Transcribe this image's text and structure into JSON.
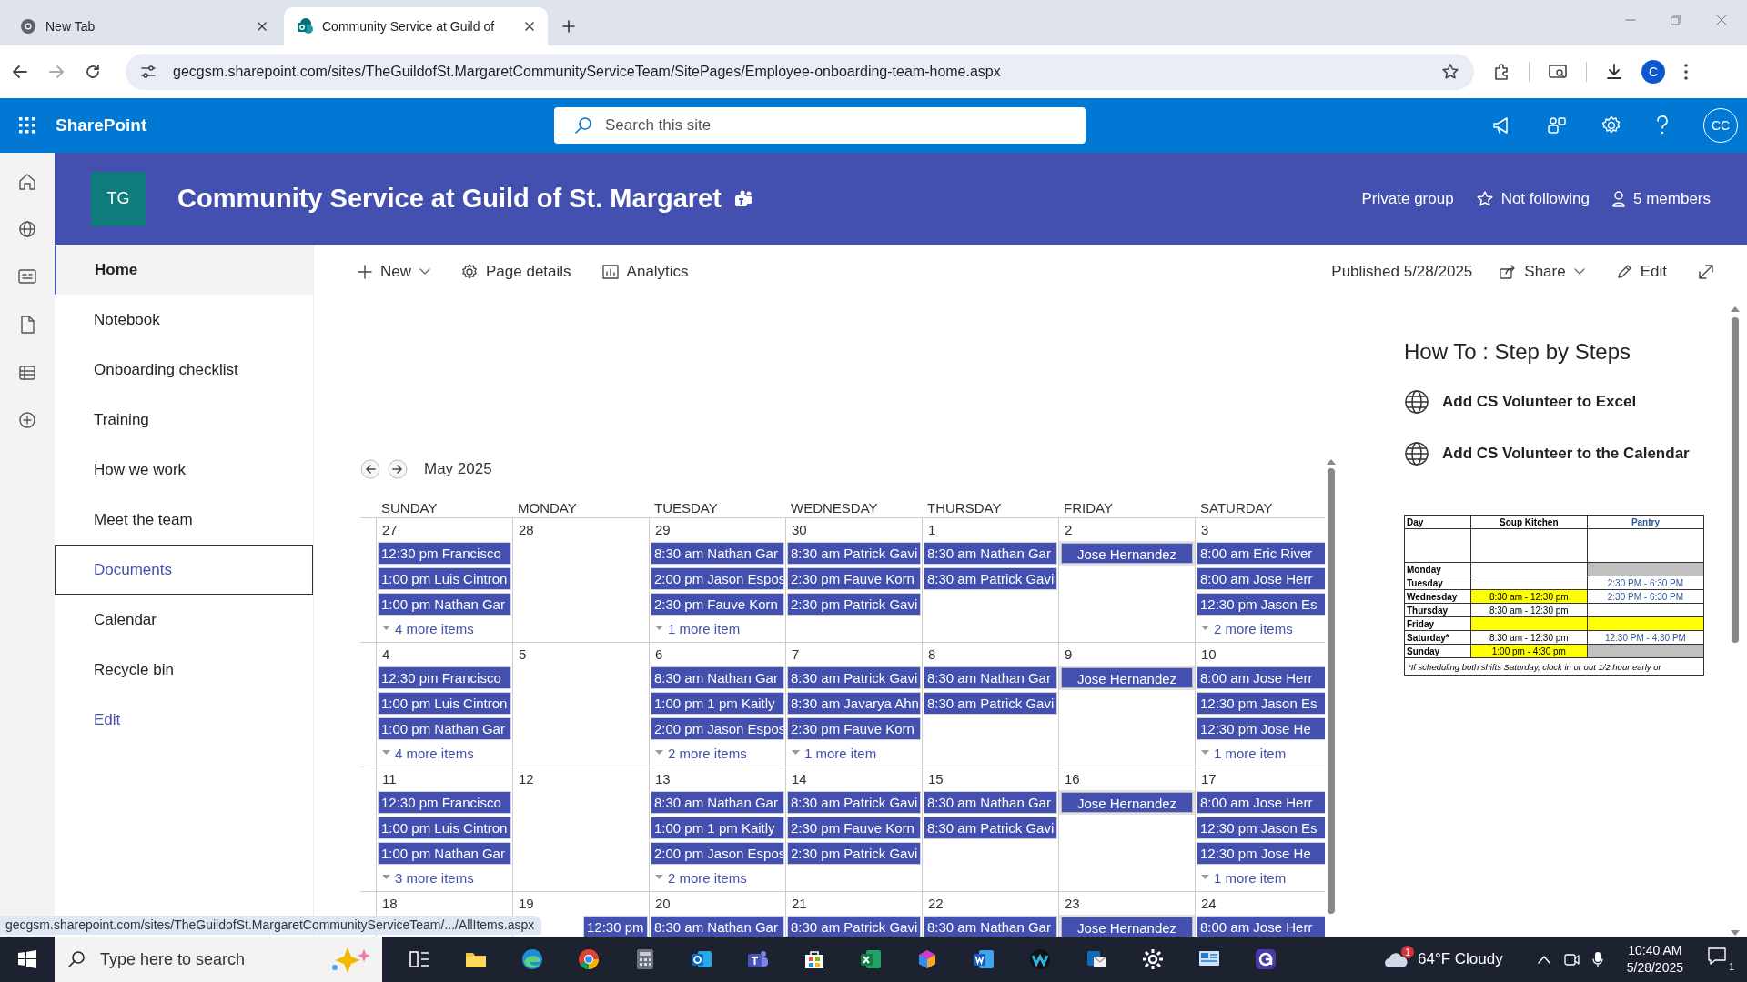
{
  "browser": {
    "tabs": [
      {
        "title": "New Tab",
        "kind": "chrome",
        "selected": false
      },
      {
        "title": "Community Service at Guild of",
        "kind": "sharepoint",
        "selected": true
      }
    ],
    "url": "gecgsm.sharepoint.com/sites/TheGuildofSt.MargaretCommunityServiceTeam/SitePages/Employee-onboarding-team-home.aspx",
    "profile": "C"
  },
  "suite_bar": {
    "app": "SharePoint",
    "search": {
      "placeholder": "Search this site"
    },
    "avatar": "CC"
  },
  "site_header": {
    "logo": "TG",
    "title": "Community Service at Guild of St. Margaret",
    "privacy": "Private group",
    "follow": "Not following",
    "members": "5 members"
  },
  "nav": [
    {
      "label": "Home",
      "kind": "page",
      "selected": true,
      "focused": false
    },
    {
      "label": "Notebook",
      "kind": "page",
      "selected": false,
      "focused": false
    },
    {
      "label": "Onboarding checklist",
      "kind": "page",
      "selected": false,
      "focused": false
    },
    {
      "label": "Training",
      "kind": "page",
      "selected": false,
      "focused": false
    },
    {
      "label": "How we work",
      "kind": "page",
      "selected": false,
      "focused": false
    },
    {
      "label": "Meet the team",
      "kind": "page",
      "selected": false,
      "focused": false
    },
    {
      "label": "Documents",
      "kind": "page",
      "selected": false,
      "focused": true
    },
    {
      "label": "Calendar",
      "kind": "page",
      "selected": false,
      "focused": false
    },
    {
      "label": "Recycle bin",
      "kind": "page",
      "selected": false,
      "focused": false
    },
    {
      "label": "Edit",
      "kind": "link",
      "selected": false,
      "focused": false
    }
  ],
  "command_bar": {
    "left": [
      {
        "label": "New",
        "kind": "new"
      },
      {
        "label": "Page details",
        "kind": "details"
      },
      {
        "label": "Analytics",
        "kind": "analytics"
      }
    ],
    "published": "Published 5/28/2025",
    "right": [
      {
        "label": "Share",
        "kind": "share"
      },
      {
        "label": "Edit",
        "kind": "edit"
      }
    ]
  },
  "calendar": {
    "month": "May 2025",
    "days": [
      "SUNDAY",
      "MONDAY",
      "TUESDAY",
      "WEDNESDAY",
      "THURSDAY",
      "FRIDAY",
      "SATURDAY"
    ],
    "weeks": [
      {
        "dates": [
          {
            "date": "27",
            "events": [
              {
                "text": "12:30 pm Francisco",
                "kind": "timed"
              },
              {
                "text": "1:00 pm Luis Cintron",
                "kind": "timed"
              },
              {
                "text": "1:00 pm Nathan Gar",
                "kind": "timed"
              }
            ],
            "more": "4 more items"
          },
          {
            "date": "28"
          },
          {
            "date": "29",
            "events": [
              {
                "text": "8:30 am Nathan Gar",
                "kind": "timed"
              },
              {
                "text": "2:00 pm Jason Espos",
                "kind": "timed"
              },
              {
                "text": "2:30 pm Fauve Korn",
                "kind": "timed"
              }
            ],
            "more": "1 more item"
          },
          {
            "date": "30",
            "events": [
              {
                "text": "8:30 am Patrick Gavi",
                "kind": "timed"
              },
              {
                "text": "2:30 pm Fauve Korn",
                "kind": "timed"
              },
              {
                "text": "2:30 pm Patrick Gavi",
                "kind": "timed"
              }
            ]
          },
          {
            "date": "1",
            "events": [
              {
                "text": "8:30 am Nathan Gar",
                "kind": "timed"
              },
              {
                "text": "8:30 am Patrick Gavi",
                "kind": "timed"
              }
            ]
          },
          {
            "date": "2",
            "events": [
              {
                "text": "Jose Hernandez",
                "kind": "allday"
              }
            ]
          },
          {
            "date": "3",
            "events": [
              {
                "text": "8:00 am Eric River",
                "kind": "timed"
              },
              {
                "text": "8:00 am Jose Herr",
                "kind": "timed"
              },
              {
                "text": "12:30 pm Jason Es",
                "kind": "timed"
              }
            ],
            "more": "2 more items"
          }
        ]
      },
      {
        "dates": [
          {
            "date": "4",
            "events": [
              {
                "text": "12:30 pm Francisco",
                "kind": "timed"
              },
              {
                "text": "1:00 pm Luis Cintron",
                "kind": "timed"
              },
              {
                "text": "1:00 pm Nathan Gar",
                "kind": "timed"
              }
            ],
            "more": "4 more items"
          },
          {
            "date": "5"
          },
          {
            "date": "6",
            "events": [
              {
                "text": "8:30 am Nathan Gar",
                "kind": "timed"
              },
              {
                "text": "1:00 pm 1 pm Kaitly",
                "kind": "timed"
              },
              {
                "text": "2:00 pm Jason Espos",
                "kind": "timed"
              }
            ],
            "more": "2 more items"
          },
          {
            "date": "7",
            "events": [
              {
                "text": "8:30 am Patrick Gavi",
                "kind": "timed"
              },
              {
                "text": "8:30 am Javarya Ahn",
                "kind": "timed"
              },
              {
                "text": "2:30 pm Fauve Korn",
                "kind": "timed"
              }
            ],
            "more": "1 more item"
          },
          {
            "date": "8",
            "events": [
              {
                "text": "8:30 am Nathan Gar",
                "kind": "timed"
              },
              {
                "text": "8:30 am Patrick Gavi",
                "kind": "timed"
              }
            ]
          },
          {
            "date": "9",
            "events": [
              {
                "text": "Jose Hernandez",
                "kind": "allday"
              }
            ]
          },
          {
            "date": "10",
            "events": [
              {
                "text": "8:00 am Jose Herr",
                "kind": "timed"
              },
              {
                "text": "12:30 pm Jason Es",
                "kind": "timed"
              },
              {
                "text": "12:30 pm Jose He",
                "kind": "timed"
              }
            ],
            "more": "1 more item"
          }
        ]
      },
      {
        "dates": [
          {
            "date": "11",
            "events": [
              {
                "text": "12:30 pm Francisco",
                "kind": "timed"
              },
              {
                "text": "1:00 pm Luis Cintron",
                "kind": "timed"
              },
              {
                "text": "1:00 pm Nathan Gar",
                "kind": "timed"
              }
            ],
            "more": "3 more items"
          },
          {
            "date": "12"
          },
          {
            "date": "13",
            "events": [
              {
                "text": "8:30 am Nathan Gar",
                "kind": "timed"
              },
              {
                "text": "1:00 pm 1 pm Kaitly",
                "kind": "timed"
              },
              {
                "text": "2:00 pm Jason Espos",
                "kind": "timed"
              }
            ],
            "more": "2 more items"
          },
          {
            "date": "14",
            "events": [
              {
                "text": "8:30 am Patrick Gavi",
                "kind": "timed"
              },
              {
                "text": "2:30 pm Fauve Korn",
                "kind": "timed"
              },
              {
                "text": "2:30 pm Patrick Gavi",
                "kind": "timed"
              }
            ]
          },
          {
            "date": "15",
            "events": [
              {
                "text": "8:30 am Nathan Gar",
                "kind": "timed"
              },
              {
                "text": "8:30 am Patrick Gavi",
                "kind": "timed"
              }
            ]
          },
          {
            "date": "16",
            "events": [
              {
                "text": "Jose Hernandez",
                "kind": "allday"
              }
            ]
          },
          {
            "date": "17",
            "events": [
              {
                "text": "8:00 am Jose Herr",
                "kind": "timed"
              },
              {
                "text": "12:30 pm Jason Es",
                "kind": "timed"
              },
              {
                "text": "12:30 pm Jose He",
                "kind": "timed"
              }
            ],
            "more": "1 more item"
          }
        ]
      },
      {
        "dates": [
          {
            "date": "18"
          },
          {
            "date": "19",
            "events": [
              {
                "text": "12:30 pm",
                "kind": "clipped"
              }
            ]
          },
          {
            "date": "20",
            "events": [
              {
                "text": "8:30 am Nathan Gar",
                "kind": "timed"
              }
            ]
          },
          {
            "date": "21",
            "events": [
              {
                "text": "8:30 am Patrick Gavi",
                "kind": "timed"
              }
            ]
          },
          {
            "date": "22",
            "events": [
              {
                "text": "8:30 am Nathan Gar",
                "kind": "timed"
              }
            ]
          },
          {
            "date": "23",
            "events": [
              {
                "text": "Jose Hernandez",
                "kind": "allday"
              }
            ]
          },
          {
            "date": "24",
            "events": [
              {
                "text": "8:00 am Jose Herr",
                "kind": "timed"
              }
            ]
          }
        ]
      }
    ]
  },
  "how_to": {
    "title": "How To : Step by Steps",
    "links": [
      "Add CS Volunteer to Excel",
      "Add CS Volunteer to the Calendar"
    ],
    "schedule": {
      "columns": [
        "Day",
        "Soup Kitchen",
        "Pantry"
      ],
      "rows": [
        {
          "kind": "blank"
        },
        {
          "kind": "day",
          "day": "Monday",
          "cells": [
            {},
            {
              "color": "#c0c0c0"
            }
          ]
        },
        {
          "kind": "day",
          "day": "Tuesday",
          "cells": [
            {},
            {
              "text": "2:30 PM - 6:30 PM"
            }
          ]
        },
        {
          "kind": "day",
          "day": "Wednesday",
          "cells": [
            {
              "text": "8:30 am - 12:30 pm",
              "color": "#ffff00"
            },
            {
              "text": "2:30 PM - 6:30 PM"
            }
          ]
        },
        {
          "kind": "day",
          "day": "Thursday",
          "cells": [
            {
              "text": "8:30 am - 12:30 pm"
            },
            {}
          ]
        },
        {
          "kind": "day",
          "day": "Friday",
          "cells": [
            {
              "color": "#ffff00"
            },
            {
              "color": "#ffff00"
            }
          ]
        },
        {
          "kind": "day",
          "day": "Saturday*",
          "cells": [
            {
              "text": "8:30 am - 12:30 pm"
            },
            {
              "text": "12:30 PM - 4:30 PM"
            }
          ]
        },
        {
          "kind": "day",
          "day": "Sunday",
          "cells": [
            {
              "text": "1:00 pm  - 4:30 pm",
              "color": "#ffff00"
            },
            {
              "color": "#c0c0c0"
            }
          ]
        }
      ],
      "footnote": "*If scheduling both shifts Saturday, clock in or out 1/2 hour early or"
    }
  },
  "status_url": "gecgsm.sharepoint.com/sites/TheGuildofSt.MargaretCommunityServiceTeam/.../AllItems.aspx",
  "taskbar": {
    "search": {
      "placeholder": "Type here to search"
    },
    "apps": [
      {
        "kind": "taskview"
      },
      {
        "kind": "folder"
      },
      {
        "kind": "edge"
      },
      {
        "kind": "chrome"
      },
      {
        "kind": "calculator"
      },
      {
        "kind": "outlook"
      },
      {
        "kind": "teams"
      },
      {
        "kind": "store"
      },
      {
        "kind": "excel"
      },
      {
        "kind": "m365"
      },
      {
        "kind": "word"
      },
      {
        "kind": "webex"
      },
      {
        "kind": "mail"
      },
      {
        "kind": "settings"
      },
      {
        "kind": "monitor"
      },
      {
        "kind": "gather"
      }
    ],
    "weather": {
      "badge": "1",
      "text": "64°F  Cloudy"
    },
    "time": "10:40 AM",
    "date": "5/28/2025",
    "notifications": "1"
  }
}
